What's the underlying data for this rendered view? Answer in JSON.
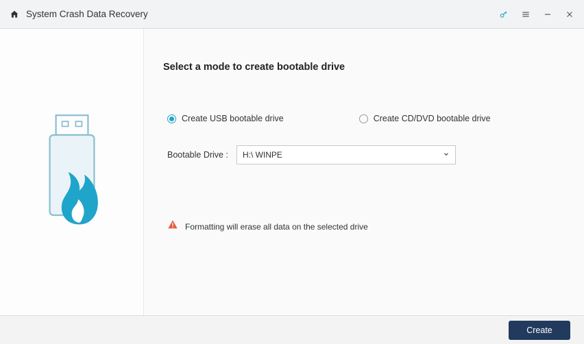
{
  "titlebar": {
    "title": "System Crash Data Recovery"
  },
  "main": {
    "heading": "Select a mode to create bootable drive",
    "radio_usb": "Create USB bootable drive",
    "radio_cd": "Create CD/DVD bootable drive",
    "selected_mode": "usb",
    "drive_label": "Bootable Drive :",
    "drive_value": "H:\\ WINPE",
    "warning": "Formatting will erase all data on the selected drive"
  },
  "footer": {
    "create_label": "Create"
  },
  "colors": {
    "accent": "#1fa5c9",
    "footer_btn": "#223a5e",
    "warning": "#e35d3f"
  }
}
